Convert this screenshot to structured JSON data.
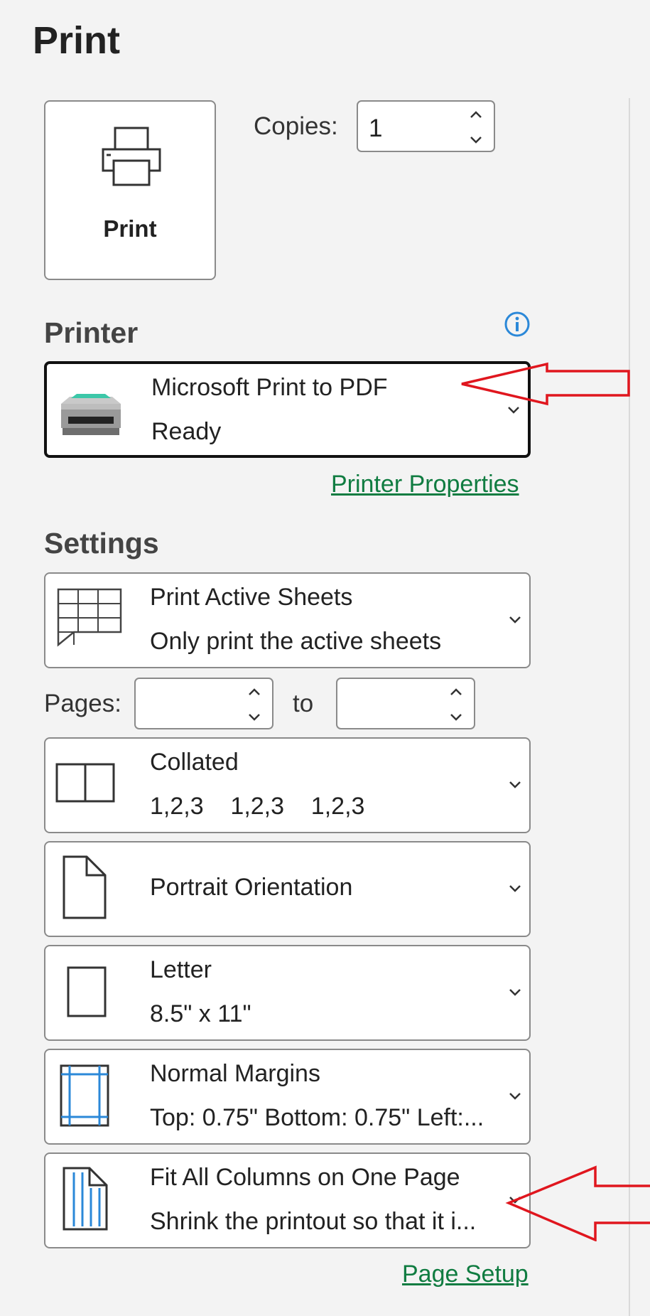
{
  "title": "Print",
  "print_button": {
    "label": "Print",
    "icon": "printer-icon"
  },
  "copies": {
    "label": "Copies:",
    "value": "1"
  },
  "printer": {
    "heading": "Printer",
    "name": "Microsoft Print to PDF",
    "status": "Ready",
    "properties_link": "Printer Properties"
  },
  "settings": {
    "heading": "Settings",
    "print_what": {
      "title": "Print Active Sheets",
      "subtitle": "Only print the active sheets"
    },
    "pages": {
      "label": "Pages:",
      "from": "",
      "to_label": "to",
      "to": ""
    },
    "collation": {
      "title": "Collated",
      "subtitle": "1,2,3    1,2,3    1,2,3"
    },
    "orientation": {
      "title": "Portrait Orientation"
    },
    "paper": {
      "title": "Letter",
      "subtitle": "8.5\" x 11\""
    },
    "margins": {
      "title": "Normal Margins",
      "subtitle": "Top: 0.75\" Bottom: 0.75\" Left:..."
    },
    "scaling": {
      "title": "Fit All Columns on One Page",
      "subtitle": "Shrink the printout so that it i..."
    },
    "page_setup_link": "Page Setup"
  },
  "colors": {
    "link": "#107c41",
    "annotation_arrow": "#e0161e",
    "accent_blue": "#2b88d8"
  }
}
